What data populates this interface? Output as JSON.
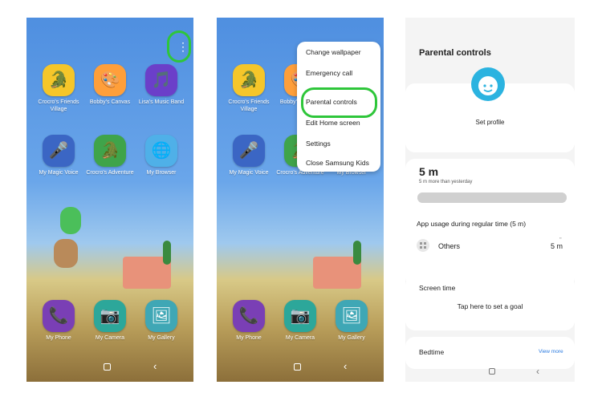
{
  "home": {
    "apps": [
      {
        "label": "Crocro's Friends Village",
        "icon": "crocro-village-icon",
        "color": "#f5c62a"
      },
      {
        "label": "Bobby's Canvas",
        "icon": "bobby-canvas-icon",
        "color": "#ff9f3a"
      },
      {
        "label": "Lisa's Music Band",
        "icon": "lisa-music-icon",
        "color": "#6b3fc9"
      },
      {
        "label": "My Magic Voice",
        "icon": "magic-voice-icon",
        "color": "#3b66c4"
      },
      {
        "label": "Crocro's Adventure",
        "icon": "crocro-adventure-icon",
        "color": "#3fa44a"
      },
      {
        "label": "My Browser",
        "icon": "browser-icon",
        "color": "#4fb0e8"
      }
    ],
    "dock": [
      {
        "label": "My Phone",
        "icon": "phone-icon",
        "color": "#7a3fb5"
      },
      {
        "label": "My Camera",
        "icon": "camera-icon",
        "color": "#2ca79a"
      },
      {
        "label": "My Gallery",
        "icon": "gallery-icon",
        "color": "#3fa7b5"
      }
    ],
    "more_options_glyph": "⋮",
    "nav_back_glyph": "‹"
  },
  "menu": {
    "items": [
      "Change wallpaper",
      "Emergency call",
      "Parental controls",
      "Edit Home screen",
      "Settings",
      "Close Samsung Kids"
    ]
  },
  "parental": {
    "title": "Parental controls",
    "set_profile": "Set profile",
    "usage_value": "5 m",
    "usage_note": "5 m more than yesterday",
    "usage_fill_percent": 100,
    "app_usage_title": "App usage during regular time (5 m)",
    "app_name": "Others",
    "app_time": "5 m",
    "app_time_small": "▪▪",
    "screen_time_title": "Screen time",
    "screen_time_action": "Tap here to set a goal",
    "bedtime_title": "Bedtime",
    "view_more": "View more",
    "accent_color": "#2bb3e0",
    "nav_back_glyph": "‹"
  }
}
